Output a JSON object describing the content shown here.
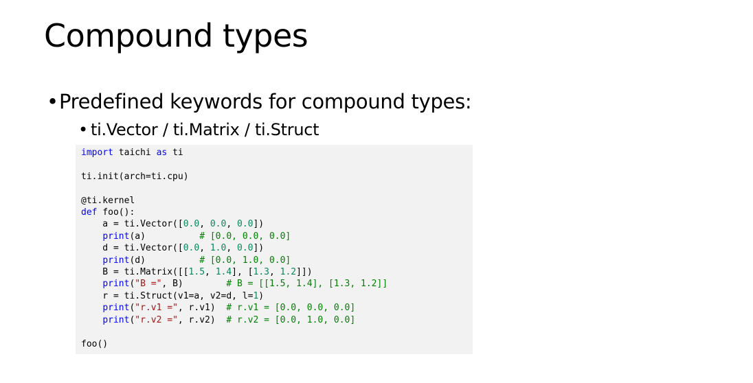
{
  "slide": {
    "title": "Compound types",
    "bullet1": "Predefined keywords for compound types:",
    "bullet2": "ti.Vector / ti.Matrix / ti.Struct",
    "bullet_glyph": "•"
  },
  "code_lines": [
    [
      {
        "t": "import",
        "c": "kw"
      },
      {
        "t": " taichi "
      },
      {
        "t": "as",
        "c": "kw"
      },
      {
        "t": " ti"
      }
    ],
    [],
    [
      {
        "t": "ti.init(arch=ti.cpu)"
      }
    ],
    [],
    [
      {
        "t": "@ti.kernel"
      }
    ],
    [
      {
        "t": "def",
        "c": "kw"
      },
      {
        "t": " foo():"
      }
    ],
    [
      {
        "t": "    a = ti.Vector(["
      },
      {
        "t": "0.0",
        "c": "nm"
      },
      {
        "t": ", "
      },
      {
        "t": "0.0",
        "c": "nm"
      },
      {
        "t": ", "
      },
      {
        "t": "0.0",
        "c": "nm"
      },
      {
        "t": "])"
      }
    ],
    [
      {
        "t": "    "
      },
      {
        "t": "print",
        "c": "kw"
      },
      {
        "t": "(a)          "
      },
      {
        "t": "# [0.0, 0.0, 0.0]",
        "c": "cm"
      }
    ],
    [
      {
        "t": "    d = ti.Vector(["
      },
      {
        "t": "0.0",
        "c": "nm"
      },
      {
        "t": ", "
      },
      {
        "t": "1.0",
        "c": "nm"
      },
      {
        "t": ", "
      },
      {
        "t": "0.0",
        "c": "nm"
      },
      {
        "t": "])"
      }
    ],
    [
      {
        "t": "    "
      },
      {
        "t": "print",
        "c": "kw"
      },
      {
        "t": "(d)          "
      },
      {
        "t": "# [0.0, 1.0, 0.0]",
        "c": "cm"
      }
    ],
    [
      {
        "t": "    B = ti.Matrix([["
      },
      {
        "t": "1.5",
        "c": "nm"
      },
      {
        "t": ", "
      },
      {
        "t": "1.4",
        "c": "nm"
      },
      {
        "t": "], ["
      },
      {
        "t": "1.3",
        "c": "nm"
      },
      {
        "t": ", "
      },
      {
        "t": "1.2",
        "c": "nm"
      },
      {
        "t": "]])"
      }
    ],
    [
      {
        "t": "    "
      },
      {
        "t": "print",
        "c": "kw"
      },
      {
        "t": "("
      },
      {
        "t": "\"B =\"",
        "c": "st"
      },
      {
        "t": ", B)        "
      },
      {
        "t": "# B = [[1.5, 1.4], [1.3, 1.2]]",
        "c": "cm"
      }
    ],
    [
      {
        "t": "    r = ti.Struct(v1=a, v2=d, l="
      },
      {
        "t": "1",
        "c": "nm"
      },
      {
        "t": ")"
      }
    ],
    [
      {
        "t": "    "
      },
      {
        "t": "print",
        "c": "kw"
      },
      {
        "t": "("
      },
      {
        "t": "\"r.v1 =\"",
        "c": "st"
      },
      {
        "t": ", r.v1)  "
      },
      {
        "t": "# r.v1 = [0.0, 0.0, 0.0]",
        "c": "cm"
      }
    ],
    [
      {
        "t": "    "
      },
      {
        "t": "print",
        "c": "kw"
      },
      {
        "t": "("
      },
      {
        "t": "\"r.v2 =\"",
        "c": "st"
      },
      {
        "t": ", r.v2)  "
      },
      {
        "t": "# r.v2 = [0.0, 1.0, 0.0]",
        "c": "cm"
      }
    ],
    [],
    [
      {
        "t": "foo()"
      }
    ]
  ]
}
